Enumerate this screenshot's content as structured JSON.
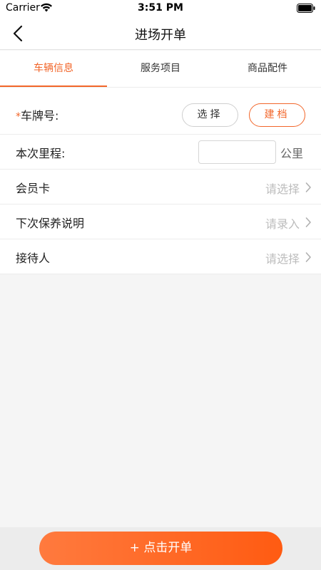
{
  "status_bar": {
    "carrier": "Carrier",
    "time": "3:51 PM",
    "wifi_icon": "wifi-icon",
    "battery_icon": "battery-icon"
  },
  "nav": {
    "title": "进场开单",
    "back_icon": "chevron-left-icon"
  },
  "tabs": [
    {
      "label": "车辆信息",
      "active": true
    },
    {
      "label": "服务项目",
      "active": false
    },
    {
      "label": "商品配件",
      "active": false
    }
  ],
  "form": {
    "plate": {
      "required_mark": "*",
      "label": "车牌号:",
      "select_label": "选择",
      "create_label": "建档"
    },
    "mileage": {
      "label": "本次里程:",
      "value": "",
      "unit": "公里"
    },
    "member_card": {
      "label": "会员卡",
      "placeholder": "请选择"
    },
    "next_maintenance": {
      "label": "下次保养说明",
      "placeholder": "请录入"
    },
    "receptionist": {
      "label": "接待人",
      "placeholder": "请选择"
    }
  },
  "bottom": {
    "button_label": "+ 点击开单"
  },
  "colors": {
    "accent": "#f2662a",
    "button_gradient_start": "#ff7a3e",
    "button_gradient_end": "#ff5b12",
    "placeholder": "#bdbdbd",
    "background": "#f5f5f5"
  }
}
